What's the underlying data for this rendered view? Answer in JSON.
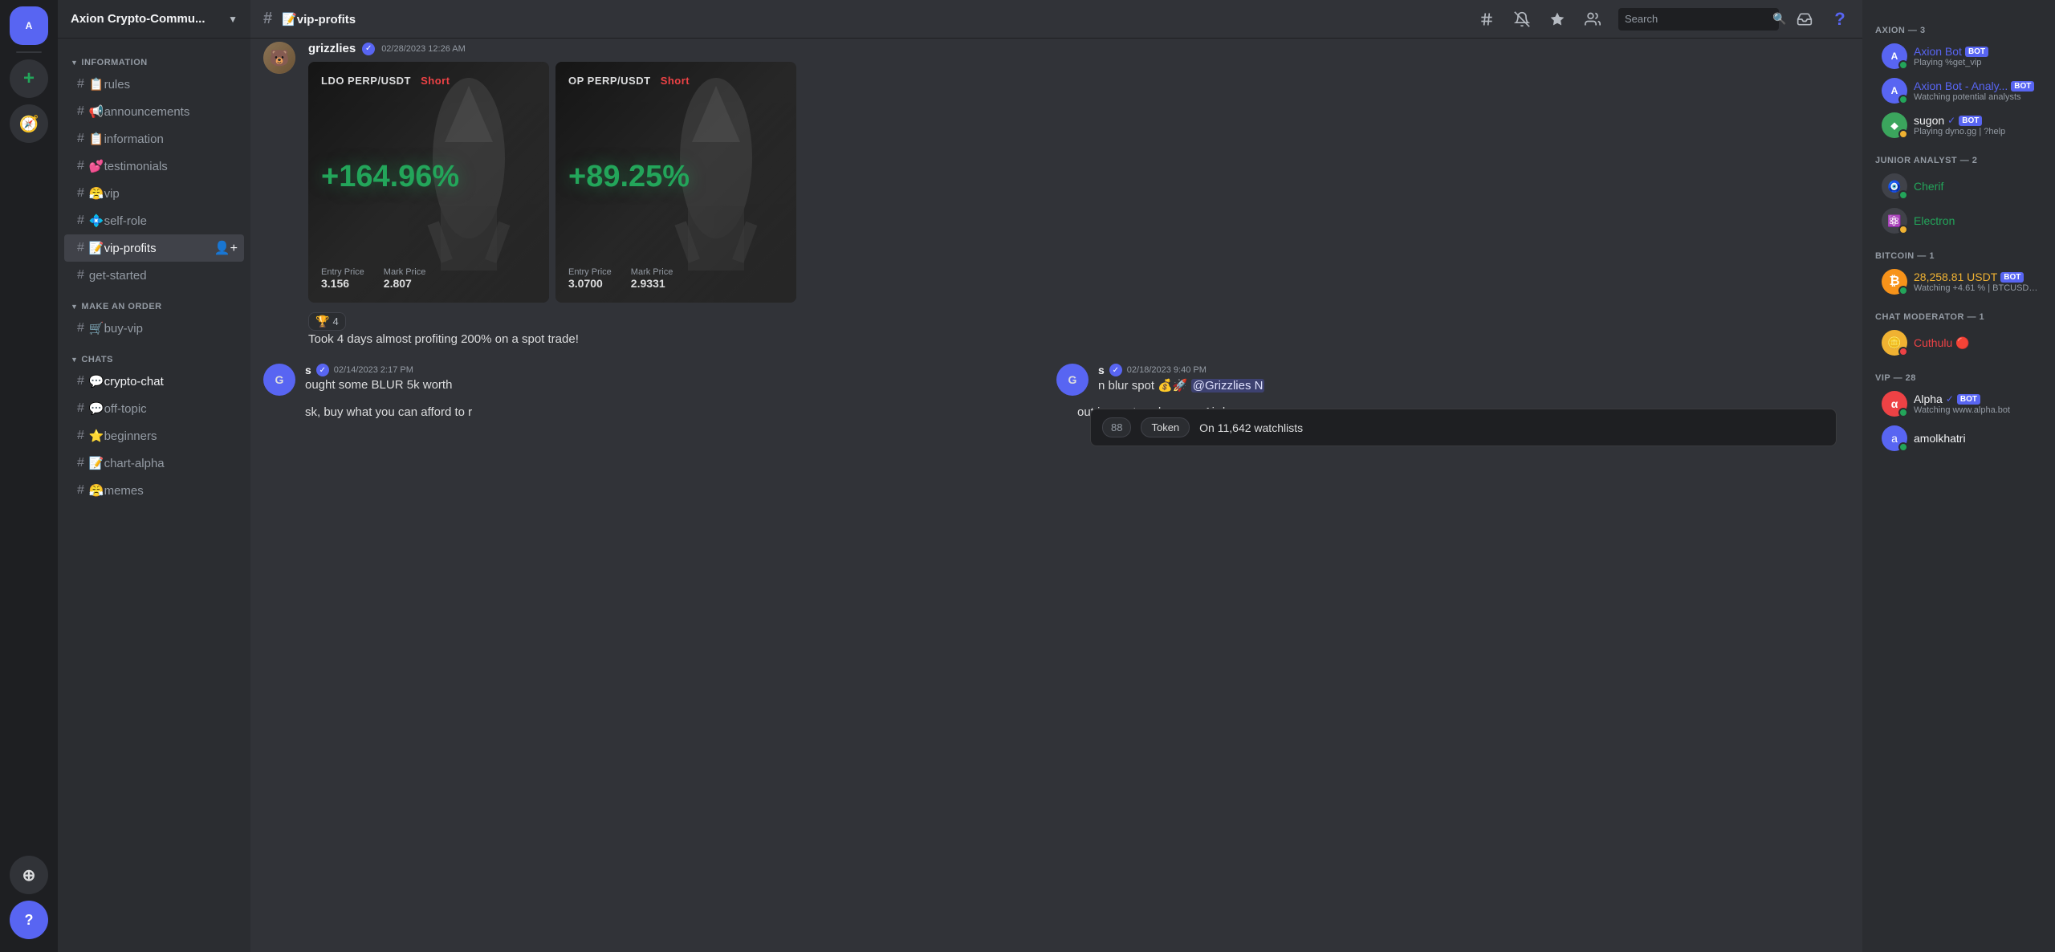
{
  "app": {
    "server_name": "Axion Crypto-Commu...",
    "channel": "vip-profits",
    "channel_prefix": "📝"
  },
  "sidebar": {
    "categories": [
      {
        "name": "INFORMATION",
        "channels": [
          {
            "icon": "📋",
            "name": "rules",
            "type": "text"
          },
          {
            "icon": "📢",
            "name": "announcements",
            "type": "text"
          },
          {
            "icon": "📋",
            "name": "information",
            "type": "text"
          },
          {
            "icon": "💕",
            "name": "testimonials",
            "type": "text"
          },
          {
            "icon": "😤",
            "name": "vip",
            "type": "text"
          },
          {
            "icon": "💠",
            "name": "self-role",
            "type": "text"
          },
          {
            "icon": "📝",
            "name": "vip-profits",
            "type": "text",
            "active": true
          },
          {
            "icon": "",
            "name": "get-started",
            "type": "text"
          }
        ]
      },
      {
        "name": "MAKE AN ORDER",
        "channels": [
          {
            "icon": "🛒",
            "name": "buy-vip",
            "type": "text"
          }
        ]
      },
      {
        "name": "CHATS",
        "channels": [
          {
            "icon": "💬",
            "name": "crypto-chat",
            "type": "text",
            "active_category": true
          },
          {
            "icon": "💬",
            "name": "off-topic",
            "type": "text"
          },
          {
            "icon": "⭐",
            "name": "beginners",
            "type": "text"
          },
          {
            "icon": "📝",
            "name": "chart-alpha",
            "type": "text"
          },
          {
            "icon": "😤",
            "name": "memes",
            "type": "text"
          }
        ]
      }
    ]
  },
  "header": {
    "channel": "vip-profits",
    "channel_prefix": "📝",
    "search_placeholder": "Search"
  },
  "messages": [
    {
      "id": "msg1",
      "author": "grizzlies",
      "verified": true,
      "timestamp": "02/28/2023 12:26 AM",
      "avatar_color": "#5865f2",
      "avatar_emoji": "🐻",
      "trades": [
        {
          "pair": "LDO PERP/USDT",
          "direction": "Short",
          "profit": "+164.96%",
          "entry_price": "3.156",
          "mark_price": "2.807"
        },
        {
          "pair": "OP PERP/USDT",
          "direction": "Short",
          "profit": "+89.25%",
          "entry_price": "3.0700",
          "mark_price": "2.9331"
        }
      ],
      "reaction_emoji": "🏆",
      "reaction_count": "4",
      "text": "Took 4 days almost profiting 200% on a spot trade!"
    }
  ],
  "partial_messages": [
    {
      "id": "pm1",
      "timestamp": "02/14/2023 2:17 PM",
      "text_snippet": "ought some BLUR 5k worth",
      "verified": true
    },
    {
      "id": "pm2",
      "timestamp": "02/18/2023 9:40 PM",
      "text_snippet": "n blur spot 💰🚀 @Grizzlies N",
      "verified": true,
      "mention": "@Grizzlies N"
    }
  ],
  "partial_text1": "sk, buy what you can afford to r",
  "partial_text2": "out in most exchanges. Airdrop :",
  "popup": {
    "number": "88",
    "token_label": "Token",
    "watchlist_text": "On 11,642 watchlists"
  },
  "members": {
    "categories": [
      {
        "name": "AXION — 3",
        "members": [
          {
            "name": "Axion Bot",
            "bot": true,
            "avatar_color": "#5865f2",
            "avatar_letter": "A",
            "status": "online",
            "activity": "Playing %get_vip",
            "name_color": "blue"
          },
          {
            "name": "Axion Bot - Analy...",
            "bot": true,
            "avatar_color": "#5865f2",
            "avatar_letter": "A",
            "status": "online",
            "activity": "Watching potential analysts",
            "name_color": "blue"
          },
          {
            "name": "sugon",
            "bot": true,
            "verified": true,
            "avatar_color": "#3ba55d",
            "avatar_letter": "S",
            "status": "idle",
            "activity": "Playing dyno.gg | ?help",
            "name_color": "normal"
          }
        ]
      },
      {
        "name": "JUNIOR ANALYST — 2",
        "members": [
          {
            "name": "Cherif",
            "avatar_color": "#5865f2",
            "avatar_letter": "C",
            "status": "online",
            "activity": "",
            "name_color": "green"
          },
          {
            "name": "Electron",
            "avatar_color": "#23a55a",
            "avatar_letter": "E",
            "status": "idle",
            "activity": "",
            "name_color": "green"
          }
        ]
      },
      {
        "name": "BITCOIN — 1",
        "members": [
          {
            "name": "28,258.81 USDT",
            "bot": true,
            "avatar_color": "#f0b232",
            "avatar_letter": "₿",
            "status": "online",
            "activity": "Watching +4.61 % | BTCUSDT ...",
            "name_color": "orange"
          }
        ]
      },
      {
        "name": "CHAT MODERATOR — 1",
        "members": [
          {
            "name": "Cuthulu",
            "avatar_color": "#ed4245",
            "avatar_letter": "C",
            "status": "dnd",
            "activity": "",
            "name_color": "red",
            "dnd_indicator": true
          }
        ]
      },
      {
        "name": "VIP — 28",
        "members": [
          {
            "name": "Alpha",
            "bot": true,
            "avatar_color": "#ed4245",
            "avatar_letter": "α",
            "status": "online",
            "activity": "Watching www.alpha.bot",
            "name_color": "normal",
            "verified": true
          },
          {
            "name": "amolkhatri",
            "avatar_color": "#5865f2",
            "avatar_letter": "a",
            "status": "online",
            "activity": "",
            "name_color": "normal"
          }
        ]
      }
    ]
  }
}
